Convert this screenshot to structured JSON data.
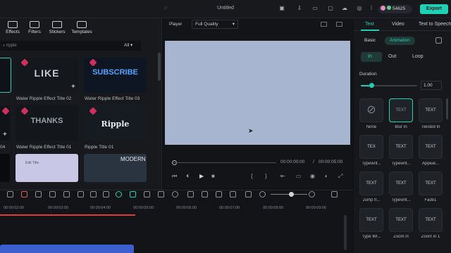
{
  "window": {
    "title": "Untitled",
    "credits": "54625",
    "export_label": "Export"
  },
  "left_nav": [
    {
      "label": "Effects",
      "icon": "effects-icon"
    },
    {
      "label": "Filters",
      "icon": "filters-icon"
    },
    {
      "label": "Stickers",
      "icon": "stickers-icon"
    },
    {
      "label": "Templates",
      "icon": "templates-icon"
    }
  ],
  "search": {
    "value": "ripple",
    "filter_label": "All"
  },
  "assets": {
    "row1": [
      {
        "caption": "",
        "thumb_text": ""
      },
      {
        "caption": "Water Ripple Effect Title 02",
        "thumb_text": "LIKE"
      },
      {
        "caption": "Water Ripple Effect Title 03",
        "thumb_text": "SUBSCRIBE"
      }
    ],
    "row2": [
      {
        "caption": "04",
        "thumb_text": ""
      },
      {
        "caption": "Water Ripple Effect Title 01",
        "thumb_text": "THANKS"
      },
      {
        "caption": "Ripple Title 01",
        "thumb_text": "Ripple"
      }
    ],
    "row3": [
      {
        "caption": "",
        "thumb_text": ""
      },
      {
        "caption": "",
        "thumb_text": "Edit Title"
      },
      {
        "caption": "",
        "thumb_text": "MODERN"
      }
    ]
  },
  "player": {
    "label": "Player",
    "quality": "Full Quality",
    "current_time": "00:00:00:00",
    "separator": "/",
    "total_time": "00:00:05:00"
  },
  "right_panel": {
    "tabs": [
      "Text",
      "Video",
      "Text to Speech"
    ],
    "subtabs": [
      "Basic",
      "Animation"
    ],
    "anim_tabs": [
      "In",
      "Out",
      "Loop"
    ],
    "duration_label": "Duration",
    "duration_value": "1.00",
    "duration_fraction": 0.15,
    "effects": [
      {
        "label": "None",
        "thumb": ""
      },
      {
        "label": "Blur In",
        "thumb": "TEXT"
      },
      {
        "label": "Twisted In",
        "thumb": "TEXT"
      },
      {
        "label": "Typewrit...",
        "thumb": "TEX"
      },
      {
        "label": "Typewrit...",
        "thumb": "TEXT"
      },
      {
        "label": "Appear...",
        "thumb": "TEXT"
      },
      {
        "label": "Jump fr...",
        "thumb": "TEXT"
      },
      {
        "label": "Typewrit...",
        "thumb": "TEXT"
      },
      {
        "label": "Fade1",
        "thumb": "TEXT"
      },
      {
        "label": "Type Wr...",
        "thumb": "TEXT"
      },
      {
        "label": "Zoom in",
        "thumb": "TEXT"
      },
      {
        "label": "Zoom in 1",
        "thumb": "TEXT"
      }
    ]
  },
  "timeline": {
    "ruler": [
      "00:00:02:00",
      "00:00:03:00",
      "00:00:04:00",
      "00:00:05:00",
      "00:00:06:00",
      "00:00:07:00",
      "00:00:08:00",
      "00:00:09:00"
    ]
  }
}
